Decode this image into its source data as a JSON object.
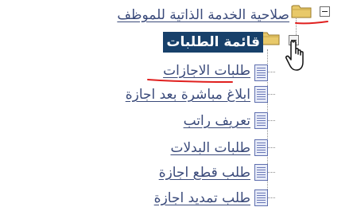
{
  "tree": {
    "root": {
      "label": "صلاحية الخدمة الذاتية للموظف",
      "toggle": "collapse"
    },
    "selected": {
      "label": "قائمة الطلبات",
      "toggle": "collapse"
    },
    "items": [
      {
        "label": "طلبات الاجازات"
      },
      {
        "label": "ابلاغ مباشرة بعد اجازة"
      },
      {
        "label": "تعريف راتب"
      },
      {
        "label": "طلبات البدلات"
      },
      {
        "label": "طلب قطع اجازة"
      },
      {
        "label": "طلب تمديد اجازة"
      }
    ]
  },
  "annotations": {
    "color": "#e0201f"
  },
  "icons": {
    "folder": "folder-icon",
    "document": "document-icon",
    "cursor": "hand-pointer-icon"
  }
}
